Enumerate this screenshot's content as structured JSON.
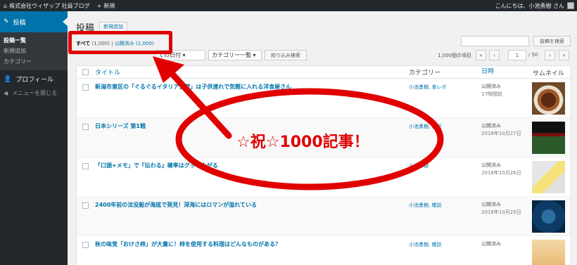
{
  "adminbar": {
    "site_name": "株式会社ウィザップ 社員ブログ",
    "new_label": "新規",
    "greeting": "こんにちは、小池勇樹 さん"
  },
  "sidebar": {
    "posts_label": "投稿",
    "sub_items": [
      "投稿一覧",
      "新規追加",
      "カテゴリー"
    ],
    "profile_label": "プロフィール",
    "collapse_label": "メニューを閉じる"
  },
  "page": {
    "title": "投稿",
    "add_new": "新規追加",
    "filter_all": "すべて",
    "filter_all_count": "(1,000)",
    "separator": "|",
    "filter_published": "公開済み",
    "filter_published_count": "(1,000)",
    "search_button": "投稿を検索"
  },
  "tablenav": {
    "date_select": "ての日付",
    "category_select": "カテゴリー一覧",
    "filter_button": "絞り込み検索",
    "items_count": "1,000個の項目",
    "first": "«",
    "prev": "‹",
    "current_page": "1",
    "total_pages": "/ 50",
    "next": "›",
    "last": "»"
  },
  "table": {
    "headers": {
      "title": "タイトル",
      "category": "カテゴリー",
      "date": "日時",
      "thumb": "サムネイル"
    },
    "rows": [
      {
        "title": "新潟市東区の「ぐるぐるイタリア食堂」は子供連れで気軽に入れる洋食屋さん",
        "category": "小池勇樹, 食レポ",
        "status": "公開済み",
        "date": "17時間前"
      },
      {
        "title": "日本シリーズ 第1戦",
        "category": "小池勇樹, 雑談",
        "status": "公開済み",
        "date": "2018年10月27日"
      },
      {
        "title": "「口頭+メモ」で『伝わる』確率はグッと上がる",
        "category": "小池勇樹",
        "status": "公開済み",
        "date": "2018年10月26日"
      },
      {
        "title": "2400年前の沈没船が海底で発見！深海にはロマンが溢れている",
        "category": "小池勇樹, 雑談",
        "status": "公開済み",
        "date": "2018年10月25日"
      },
      {
        "title": "秋の味覚「おけさ柿」が大量に！柿を使用する料理はどんなものがある？",
        "category": "小池勇樹, 雑談",
        "status": "公開済み",
        "date": ""
      }
    ]
  },
  "annotation": {
    "text": "☆祝☆1000記事！",
    "color": "#e00000"
  },
  "colors": {
    "accent": "#0073aa",
    "adminbar": "#23282d",
    "annotation": "#e00000"
  },
  "icons": [
    "wordpress-home-icon",
    "plus-icon",
    "pin-icon",
    "user-icon",
    "collapse-icon",
    "avatar-icon"
  ]
}
